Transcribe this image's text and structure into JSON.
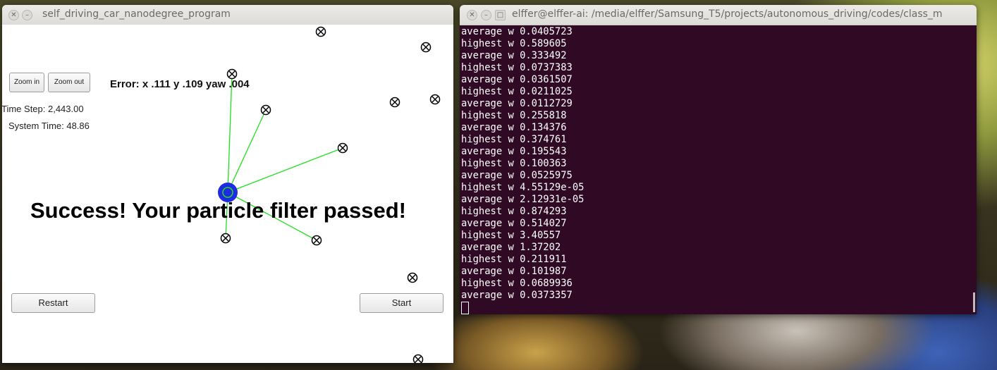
{
  "sim_window": {
    "title": "self_driving_car_nanodegree_program",
    "zoom_in": "Zoom in",
    "zoom_out": "Zoom out",
    "error": "Error: x .111 y .109 yaw .004",
    "time_step": "Time Step: 2,443.00",
    "system_time": "System Time: 48.86",
    "success": "Success! Your particle filter passed!",
    "restart": "Restart",
    "start": "Start",
    "colors": {
      "vehicle": "#1f2be0",
      "ray": "#1fe01f"
    }
  },
  "terminal_window": {
    "title": "elffer@elffer-ai: /media/elffer/Samsung_T5/projects/autonomous_driving/codes/class_m",
    "lines": [
      "average w 0.0405723",
      "highest w 0.589605",
      "average w 0.333492",
      "highest w 0.0737383",
      "average w 0.0361507",
      "highest w 0.0211025",
      "average w 0.0112729",
      "highest w 0.255818",
      "average w 0.134376",
      "highest w 0.374761",
      "average w 0.195543",
      "highest w 0.100363",
      "average w 0.0525975",
      "highest w 4.55129e-05",
      "average w 2.12931e-05",
      "highest w 0.874293",
      "average w 0.514027",
      "highest w 3.40557",
      "average w 1.37202",
      "highest w 0.211911",
      "average w 0.101987",
      "highest w 0.0689936",
      "average w 0.0373357"
    ]
  }
}
